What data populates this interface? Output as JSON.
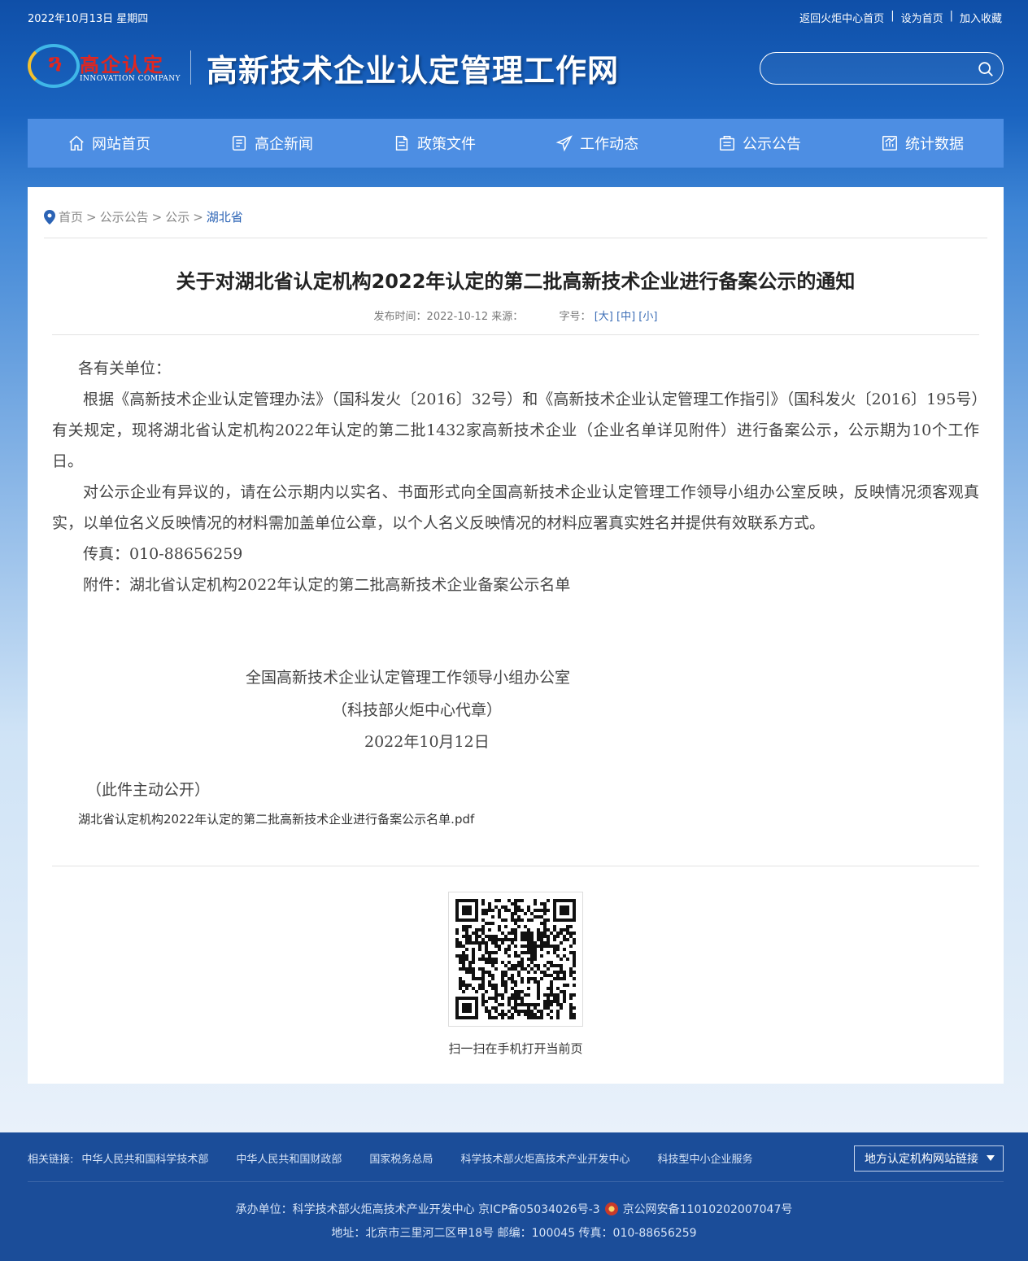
{
  "topbar": {
    "date": "2022年10月13日 星期四",
    "links": [
      "返回火炬中心首页",
      "设为首页",
      "加入收藏"
    ]
  },
  "header": {
    "logo_cn": "高企认定",
    "logo_en": "INNOVATION COMPANY",
    "site_title": "高新技术企业认定管理工作网",
    "search_placeholder": ""
  },
  "nav": {
    "items": [
      {
        "label": "网站首页",
        "icon": "home-icon"
      },
      {
        "label": "高企新闻",
        "icon": "news-icon"
      },
      {
        "label": "政策文件",
        "icon": "document-icon"
      },
      {
        "label": "工作动态",
        "icon": "send-icon"
      },
      {
        "label": "公示公告",
        "icon": "notice-icon"
      },
      {
        "label": "统计数据",
        "icon": "chart-icon"
      }
    ]
  },
  "breadcrumb": {
    "items": [
      "首页",
      "公示公告",
      "公示"
    ],
    "current": "湖北省",
    "separator": ">"
  },
  "article": {
    "title": "关于对湖北省认定机构2022年认定的第二批高新技术企业进行备案公示的通知",
    "meta_publish_label": "发布时间：",
    "meta_date": "2022-10-12",
    "meta_source_label": "来源：",
    "meta_fontsize_label": "字号：",
    "size_large": "[大]",
    "size_medium": "[中]",
    "size_small": "[小]",
    "greeting": "各有关单位：",
    "para1": "根据《高新技术企业认定管理办法》（国科发火〔2016〕32号）和《高新技术企业认定管理工作指引》（国科发火〔2016〕195号）有关规定，现将湖北省认定机构2022年认定的第二批1432家高新技术企业（企业名单详见附件）进行备案公示，公示期为10个工作日。",
    "para2": "对公示企业有异议的，请在公示期内以实名、书面形式向全国高新技术企业认定管理工作领导小组办公室反映，反映情况须客观真实，以单位名义反映情况的材料需加盖单位公章，以个人名义反映情况的材料应署真实姓名并提供有效联系方式。",
    "fax": "传真：010-88656259",
    "attachment_text": "附件：湖北省认定机构2022年认定的第二批高新技术企业备案公示名单",
    "sign_org": "全国高新技术企业认定管理工作领导小组办公室",
    "sign_proxy": "（科技部火炬中心代章）",
    "sign_date": "2022年10月12日",
    "open_note": "（此件主动公开）",
    "attachment_link": "湖北省认定机构2022年认定的第二批高新技术企业进行备案公示名单.pdf"
  },
  "qr": {
    "caption": "扫一扫在手机打开当前页"
  },
  "footer": {
    "links_label": "相关链接:",
    "links": [
      "中华人民共和国科学技术部",
      "中华人民共和国财政部",
      "国家税务总局",
      "科学技术部火炬高技术产业开发中心",
      "科技型中小企业服务"
    ],
    "select_label": "地方认定机构网站链接",
    "info1_a": "承办单位：科学技术部火炬高技术产业开发中心 京ICP备05034026号-3",
    "info1_b": "京公网安备11010202007047号",
    "info2": "地址：北京市三里河二区甲18号 邮编：100045 传真：010-88656259"
  },
  "colors": {
    "nav_bg": "#4d8ee3",
    "footer_bg": "#1b4d99",
    "link_blue": "#2b63b5",
    "logo_red": "#e2261f"
  }
}
